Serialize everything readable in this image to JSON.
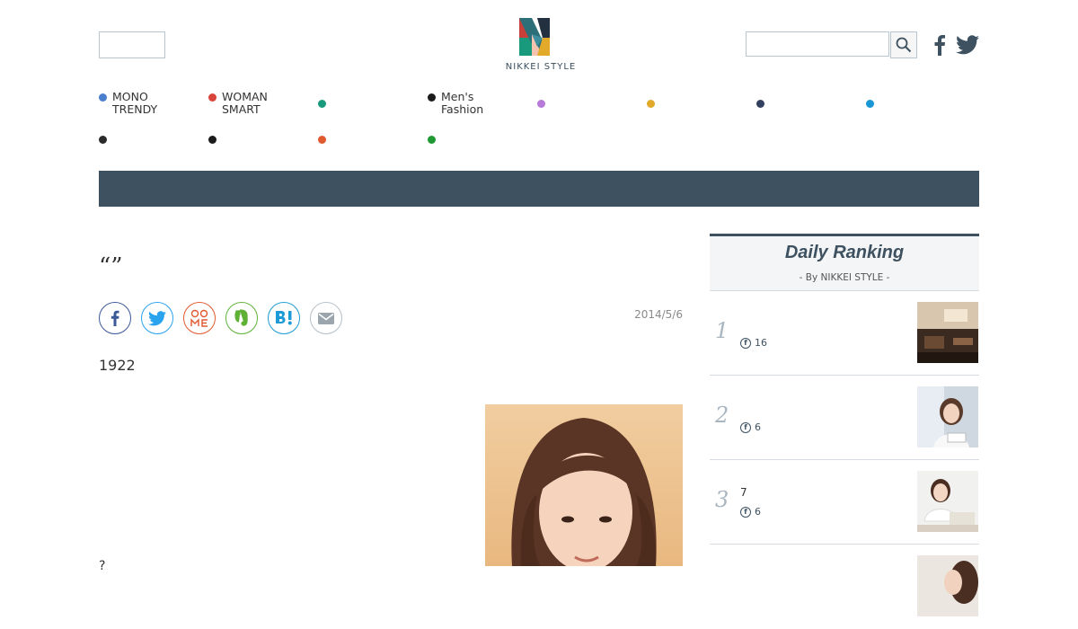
{
  "header": {
    "logo_text": "NIKKEI STYLE",
    "search": {
      "placeholder": ""
    }
  },
  "categories": [
    {
      "label": "MONO\nTRENDY",
      "color": "#4a7fcf"
    },
    {
      "label": "WOMAN\nSMART",
      "color": "#d9443a"
    },
    {
      "label": "",
      "color": "#1a9a7c"
    },
    {
      "label": "Men's\nFashion",
      "color": "#1b1b1b"
    },
    {
      "label": "",
      "color": "#b77ad9"
    },
    {
      "label": "",
      "color": "#e2a92a"
    },
    {
      "label": "",
      "color": "#334060"
    },
    {
      "label": "",
      "color": "#1996d6"
    },
    {
      "label": "",
      "color": "#2b2b2b"
    },
    {
      "label": "",
      "color": "#1b1b1b"
    },
    {
      "label": "",
      "color": "#e0592f"
    },
    {
      "label": "",
      "color": "#1f9a33"
    }
  ],
  "article": {
    "title": "“”",
    "date": "2014/5/6",
    "lead": "1922",
    "trailing_text": "?"
  },
  "share_buttons": [
    {
      "name": "facebook-share-icon",
      "color": "#3b5998"
    },
    {
      "name": "twitter-share-icon",
      "color": "#2aa3ef"
    },
    {
      "name": "comemo-share-icon",
      "color": "#e0592f"
    },
    {
      "name": "evernote-share-icon",
      "color": "#5fb135"
    },
    {
      "name": "hatena-bookmark-icon",
      "color": "#1d9bd7"
    },
    {
      "name": "mail-share-icon",
      "color": "#9aa5ad"
    }
  ],
  "ranking": {
    "title": "Daily Ranking",
    "subtitle": "- By NIKKEI STYLE -",
    "items": [
      {
        "rank": "1",
        "text": "",
        "fb_count": "16"
      },
      {
        "rank": "2",
        "text": "",
        "fb_count": "6"
      },
      {
        "rank": "3",
        "text": "7",
        "fb_count": "6"
      }
    ]
  }
}
